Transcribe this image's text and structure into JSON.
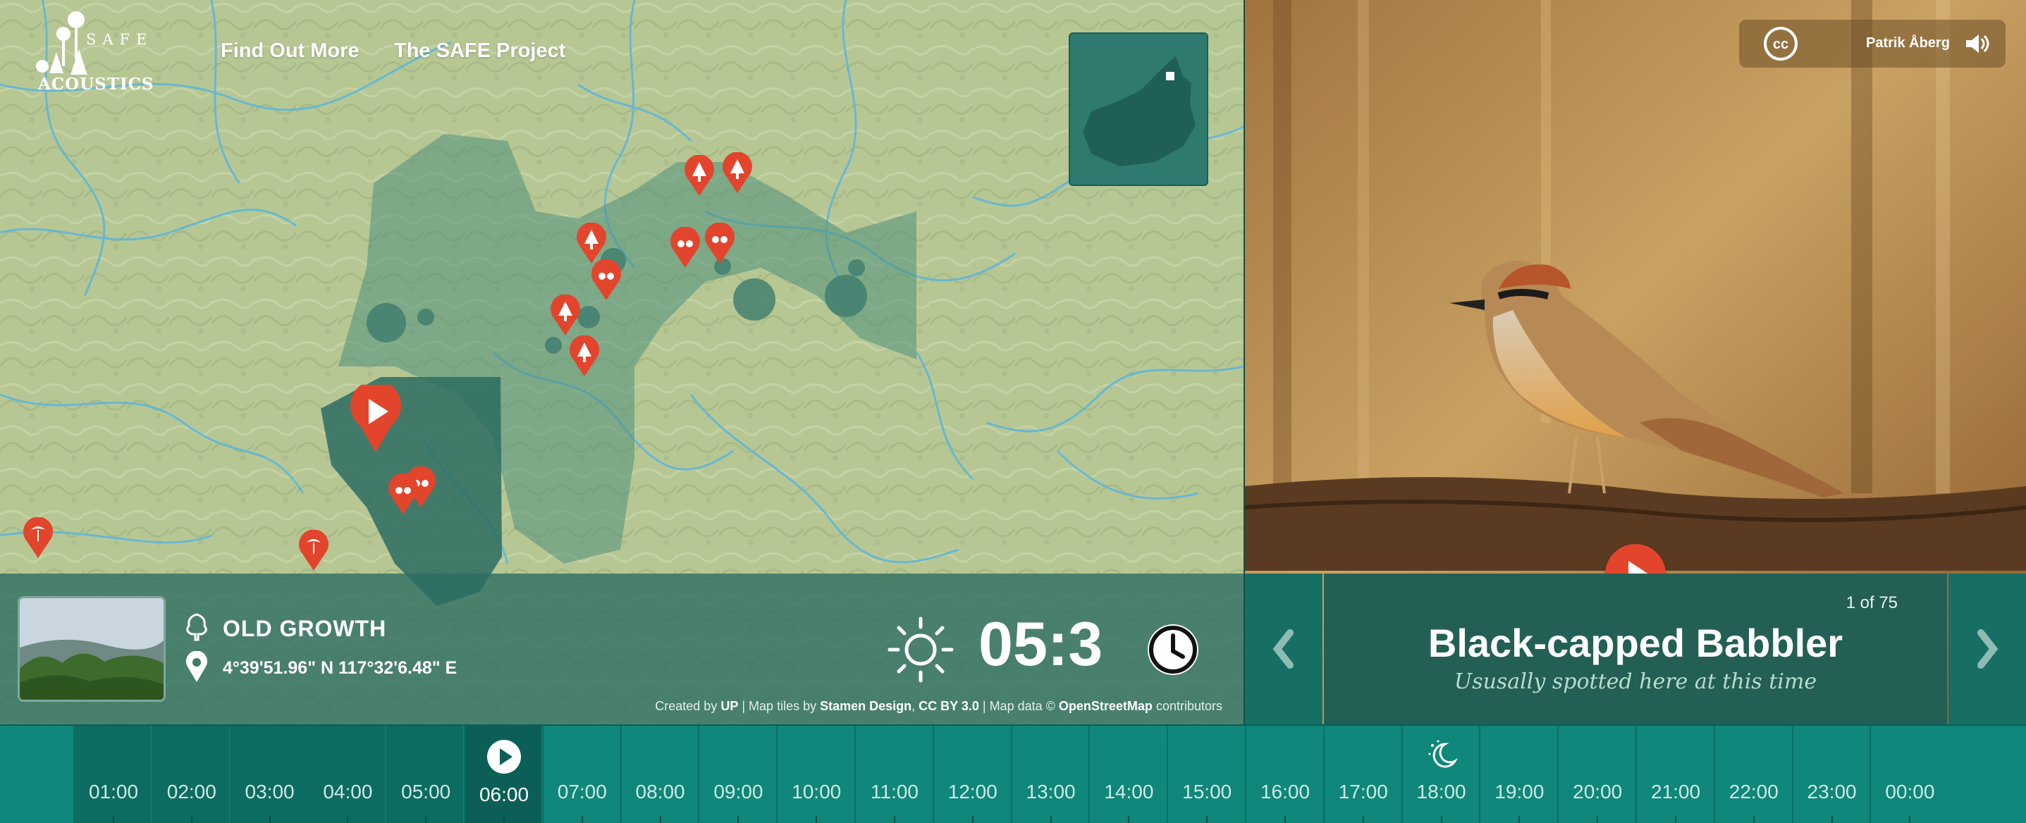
{
  "header": {
    "logo_top": "SAFE",
    "logo_bottom": "ACOUSTICS",
    "nav": [
      "Find Out More",
      "The SAFE Project"
    ]
  },
  "site": {
    "name": "OLD GROWTH",
    "coordinates": "4°39'51.96\" N 117°32'6.48\" E",
    "time": "05:3",
    "icons": [
      "tree-icon",
      "location-pin-icon",
      "sun-icon",
      "clock-icon"
    ]
  },
  "credits": {
    "created_by_prefix": "Created by",
    "created_by": "UP",
    "tiles_prefix": "| Map tiles by",
    "tiles_by": "Stamen Design",
    "license": "CC BY 3.0",
    "data_prefix": "| Map data ©",
    "data_by": "OpenStreetMap",
    "data_suffix": "contributors"
  },
  "photo_credit": {
    "license_icon": "creative-commons-icon",
    "author": "Patrik Åberg",
    "sound_icon": "speaker-icon"
  },
  "bird": {
    "counter": "1 of 75",
    "name": "Black-capped Babbler",
    "subtitle": "Ususally spotted here at this time"
  },
  "timeline": {
    "hours": [
      "01:00",
      "02:00",
      "03:00",
      "04:00",
      "05:00",
      "06:00",
      "07:00",
      "08:00",
      "09:00",
      "10:00",
      "11:00",
      "12:00",
      "13:00",
      "14:00",
      "15:00",
      "16:00",
      "17:00",
      "18:00",
      "19:00",
      "20:00",
      "21:00",
      "22:00",
      "23:00",
      "00:00"
    ],
    "active": "06:00",
    "night_marker": "18:00"
  },
  "colors": {
    "accent_red": "#e2452c",
    "teal_dark": "#0b5f56",
    "teal": "#0f877a",
    "map_land": "#b5c592"
  }
}
